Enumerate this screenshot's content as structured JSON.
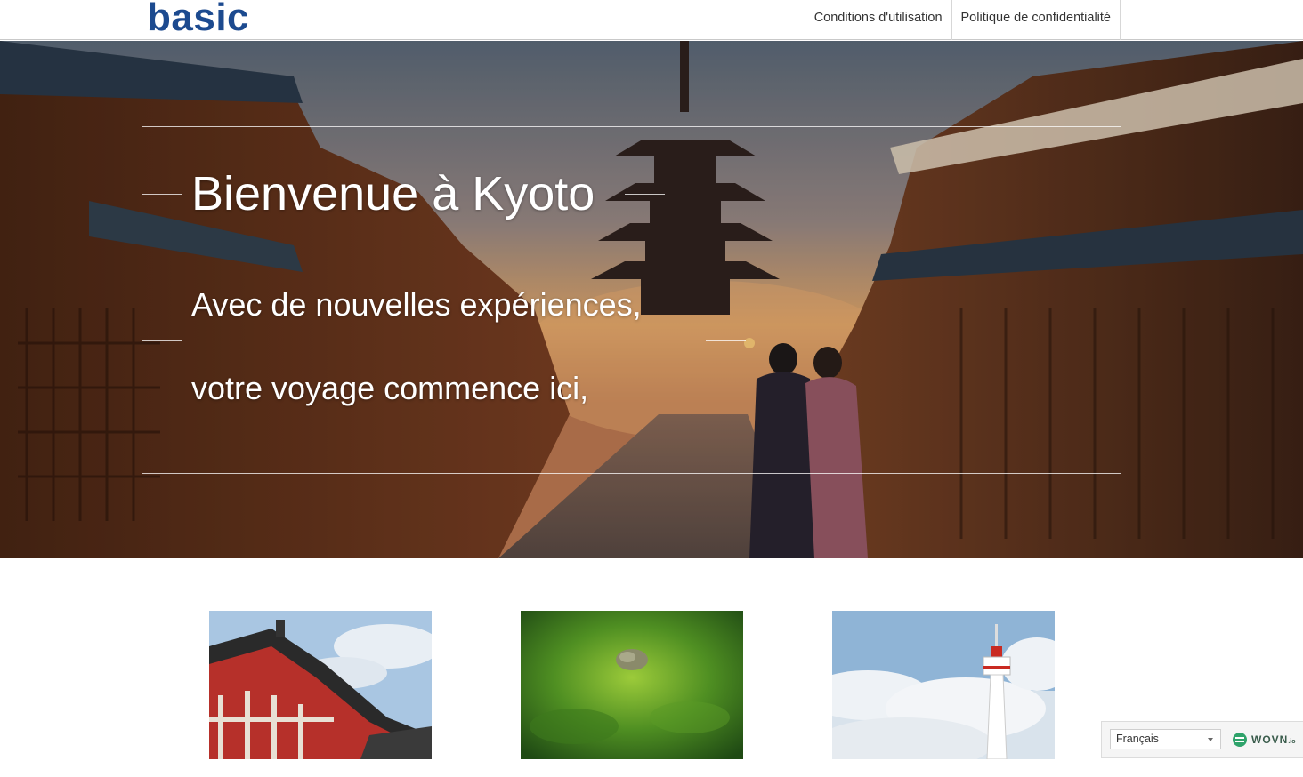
{
  "header": {
    "logo": "basic",
    "nav": [
      {
        "label": "Conditions d'utilisation"
      },
      {
        "label": "Politique de confidentialité"
      }
    ]
  },
  "hero": {
    "title": "Bienvenue à Kyoto",
    "subtitle_line1": "Avec de nouvelles expériences,",
    "subtitle_line2": "votre voyage commence ici,"
  },
  "language_widget": {
    "selected_language": "Français",
    "brand": "WOVN",
    "brand_suffix": ".io"
  },
  "colors": {
    "logo": "#1c4a8f",
    "wovn_green": "#2fa36b"
  }
}
